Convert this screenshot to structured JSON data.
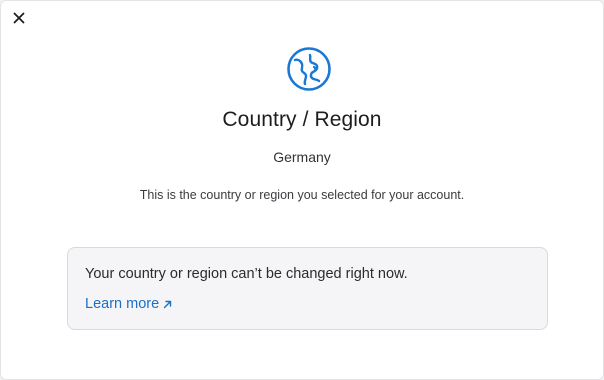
{
  "dialog": {
    "close_icon": "close-icon",
    "globe_icon": "globe-icon",
    "title": "Country / Region",
    "country": "Germany",
    "description": "This is the country or region you selected for your account.",
    "notice": {
      "text": "Your country or region can’t be changed right now.",
      "link_label": "Learn more",
      "link_icon": "external-arrow-icon"
    }
  },
  "colors": {
    "accent": "#1a6fc9",
    "globe": "#1b78d4",
    "notice_bg": "#f5f5f7"
  }
}
